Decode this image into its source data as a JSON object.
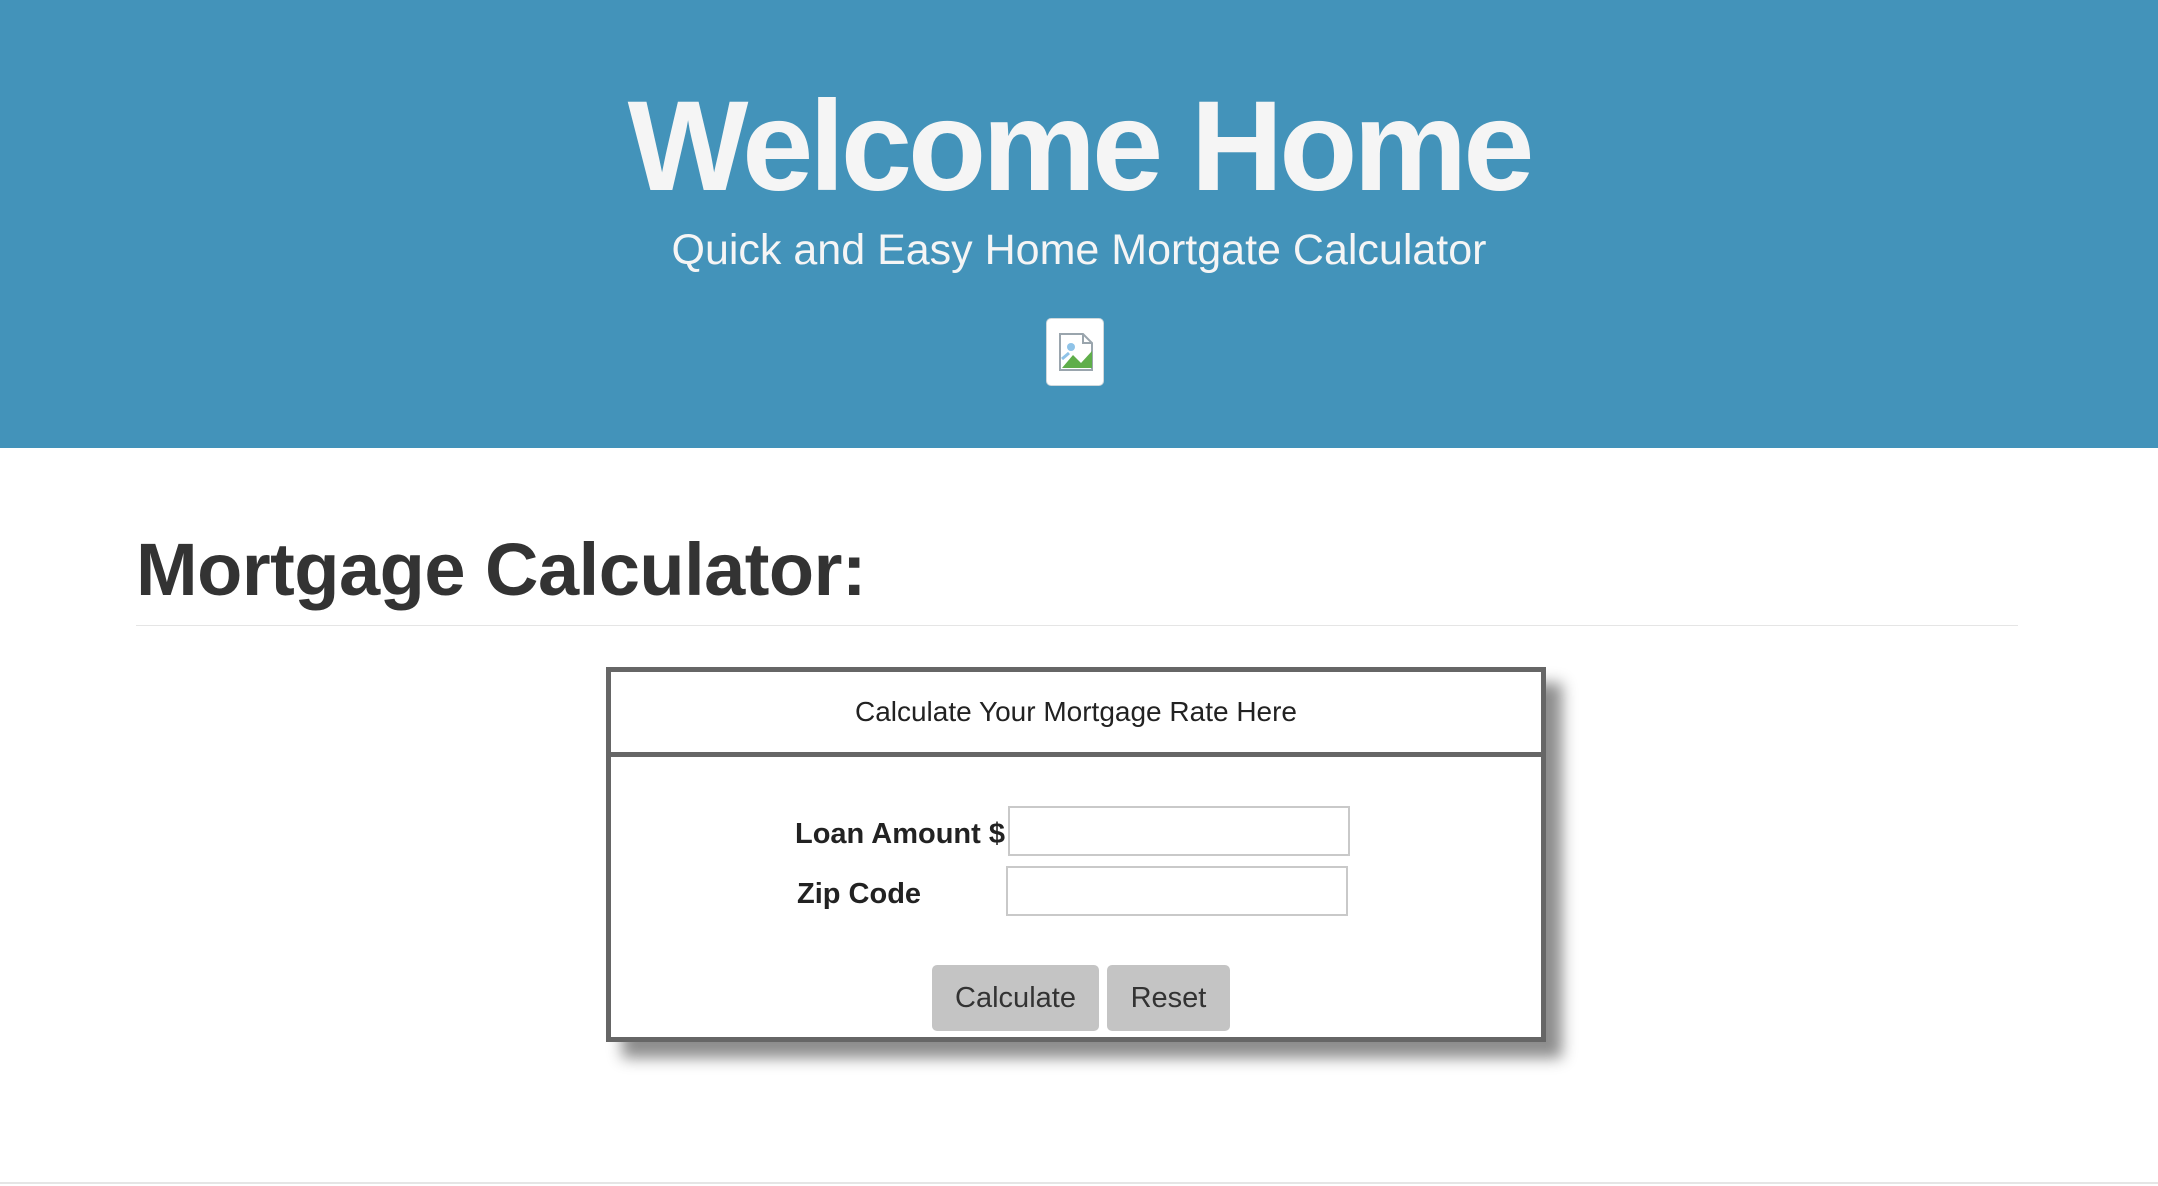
{
  "hero": {
    "title": "Welcome Home",
    "subtitle": "Quick and Easy Home Mortgate Calculator",
    "background_color": "#4393ba",
    "image_icon": "broken-image-icon"
  },
  "main": {
    "section_title": "Mortgage Calculator:",
    "calculator": {
      "header": "Calculate Your Mortgage Rate Here",
      "fields": [
        {
          "label": "Loan Amount $",
          "value": "",
          "placeholder": ""
        },
        {
          "label": "Zip Code",
          "value": "",
          "placeholder": ""
        }
      ],
      "buttons": {
        "calculate_label": "Calculate",
        "reset_label": "Reset"
      }
    }
  }
}
